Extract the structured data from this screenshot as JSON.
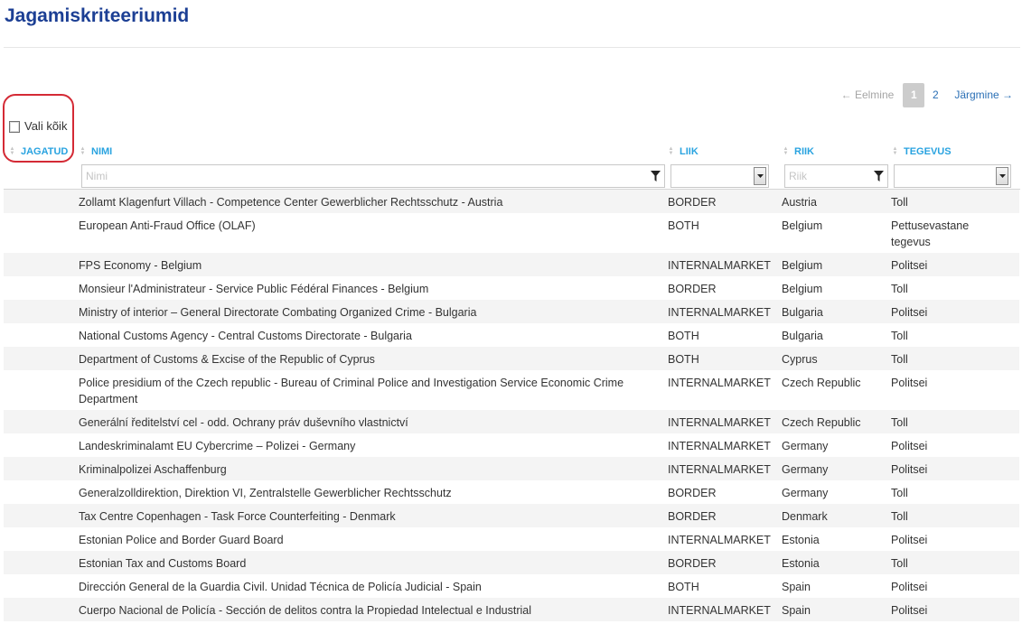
{
  "page": {
    "title": "Jagamiskriteeriumid"
  },
  "pagination": {
    "prev_label": "← Eelmine",
    "pages": [
      "1",
      "2"
    ],
    "current": "1",
    "next_label": "Järgmine →"
  },
  "select_all": {
    "label": "Vali kõik",
    "checked": false
  },
  "columns": {
    "shared": "JAGATUD",
    "name": "NIMI",
    "type": "LIIK",
    "country": "RIIK",
    "action": "TEGEVUS"
  },
  "filters": {
    "name_placeholder": "Nimi",
    "type_value": "",
    "country_placeholder": "Riik",
    "action_value": ""
  },
  "rows": [
    {
      "name": "Zollamt Klagenfurt Villach - Competence Center Gewerblicher Rechtsschutz - Austria",
      "type": "BORDER",
      "country": "Austria",
      "action": "Toll"
    },
    {
      "name": "European Anti-Fraud Office (OLAF)",
      "type": "BOTH",
      "country": "Belgium",
      "action": "Pettusevastane tegevus"
    },
    {
      "name": "FPS Economy - Belgium",
      "type": "INTERNALMARKET",
      "country": "Belgium",
      "action": "Politsei"
    },
    {
      "name": "Monsieur l'Administrateur - Service Public Fédéral Finances - Belgium",
      "type": "BORDER",
      "country": "Belgium",
      "action": "Toll"
    },
    {
      "name": "Ministry of interior – General Directorate Combating Organized Crime - Bulgaria",
      "type": "INTERNALMARKET",
      "country": "Bulgaria",
      "action": "Politsei"
    },
    {
      "name": "National Customs Agency - Central Customs Directorate - Bulgaria",
      "type": "BOTH",
      "country": "Bulgaria",
      "action": "Toll"
    },
    {
      "name": "Department of Customs & Excise of the Republic of Cyprus",
      "type": "BOTH",
      "country": "Cyprus",
      "action": "Toll"
    },
    {
      "name": "Police presidium of the Czech republic - Bureau of Criminal Police and Investigation Service Economic Crime Department",
      "type": "INTERNALMARKET",
      "country": "Czech Republic",
      "action": "Politsei"
    },
    {
      "name": "Generální ředitelství cel - odd. Ochrany práv duševního vlastnictví",
      "type": "INTERNALMARKET",
      "country": "Czech Republic",
      "action": "Toll"
    },
    {
      "name": "Landeskriminalamt EU Cybercrime – Polizei - Germany",
      "type": "INTERNALMARKET",
      "country": "Germany",
      "action": "Politsei"
    },
    {
      "name": "Kriminalpolizei Aschaffenburg",
      "type": "INTERNALMARKET",
      "country": "Germany",
      "action": "Politsei"
    },
    {
      "name": "Generalzolldirektion, Direktion VI, Zentralstelle Gewerblicher Rechtsschutz",
      "type": "BORDER",
      "country": "Germany",
      "action": "Toll"
    },
    {
      "name": "Tax Centre Copenhagen - Task Force Counterfeiting - Denmark",
      "type": "BORDER",
      "country": "Denmark",
      "action": "Toll"
    },
    {
      "name": "Estonian Police and Border Guard Board",
      "type": "INTERNALMARKET",
      "country": "Estonia",
      "action": "Politsei"
    },
    {
      "name": "Estonian Tax and Customs Board",
      "type": "BORDER",
      "country": "Estonia",
      "action": "Toll"
    },
    {
      "name": "Dirección General de la Guardia Civil. Unidad Técnica de Policía Judicial - Spain",
      "type": "BOTH",
      "country": "Spain",
      "action": "Politsei"
    },
    {
      "name": "Cuerpo Nacional de Policía - Sección de delitos contra la Propiedad Intelectual e Industrial",
      "type": "INTERNALMARKET",
      "country": "Spain",
      "action": "Politsei"
    }
  ],
  "colors": {
    "title": "#1c3f94",
    "header": "#29a3e0",
    "link": "#2a6fb5",
    "highlight_oval": "#d42a35"
  }
}
